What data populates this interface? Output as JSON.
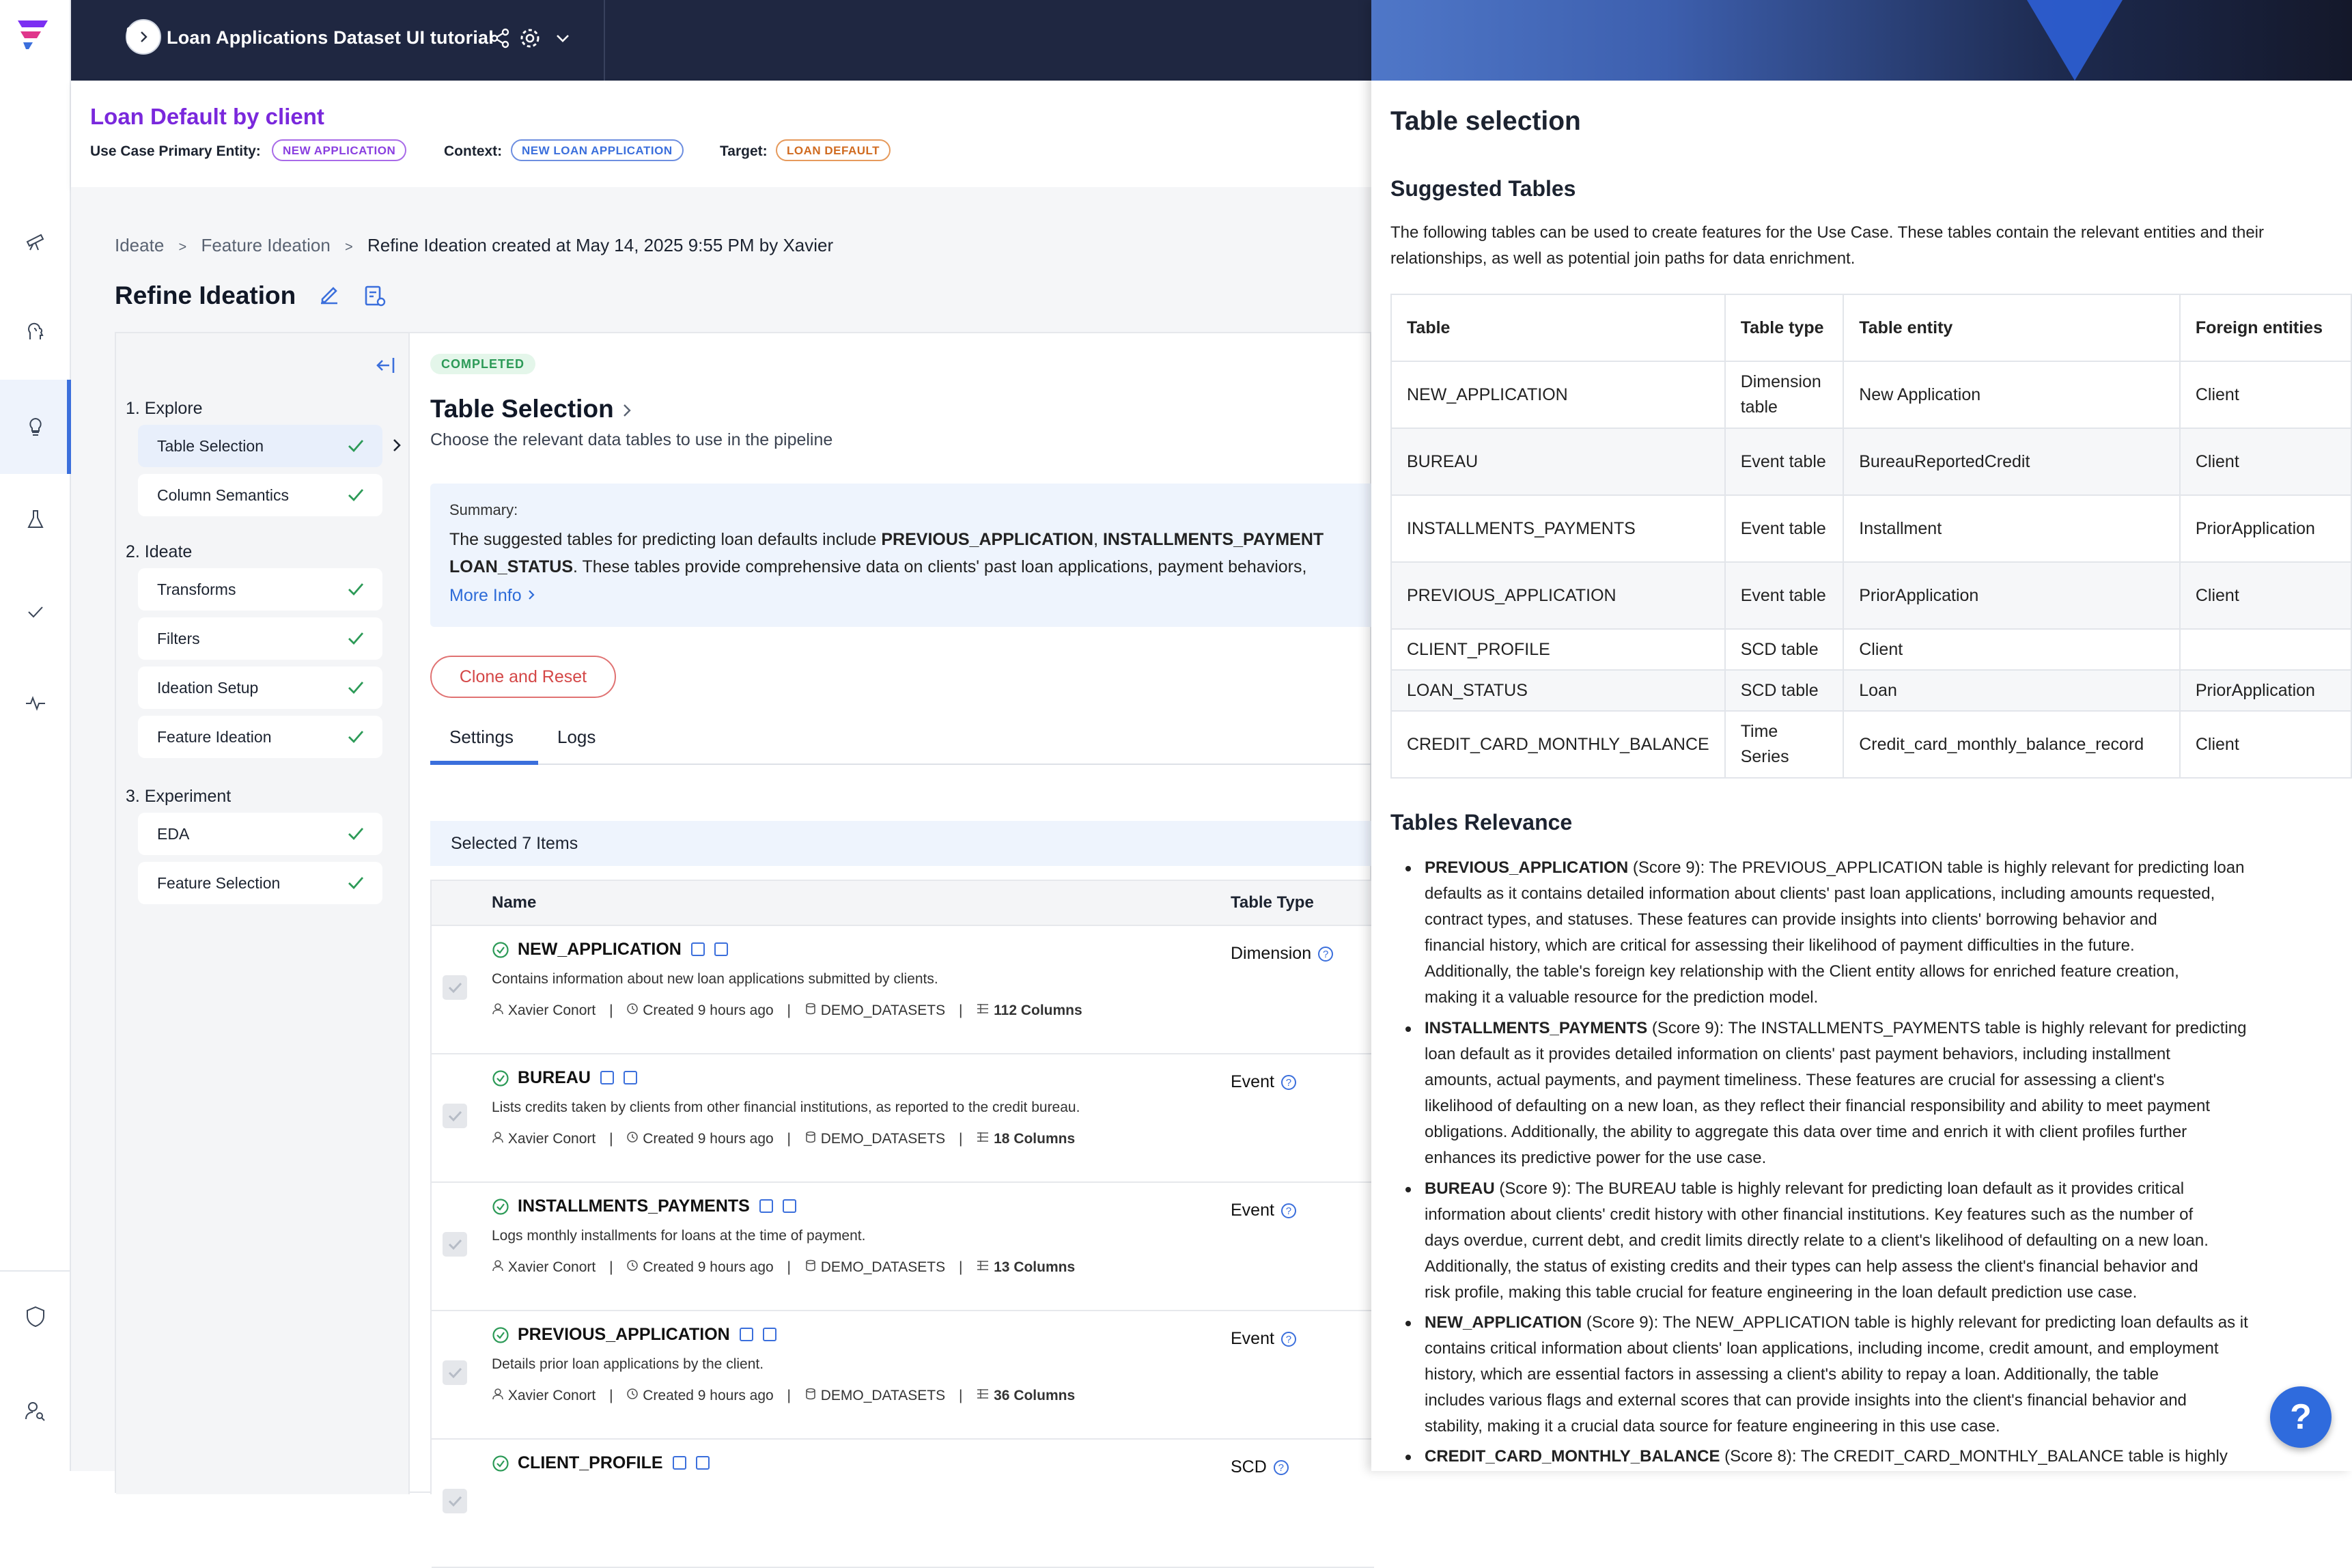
{
  "topbar": {
    "title": "Loan Applications Dataset UI tutorial"
  },
  "header": {
    "use_case_title": "Loan Default by client",
    "primary_entity_label": "Use Case Primary Entity:",
    "primary_entity": "NEW APPLICATION",
    "context_label": "Context:",
    "context": "NEW LOAN APPLICATION",
    "target_label": "Target:",
    "target": "LOAN DEFAULT"
  },
  "breadcrumb": [
    "Ideate",
    ">",
    "Feature Ideation",
    ">",
    "Refine Ideation created at May 14, 2025 9:55 PM by Xavier"
  ],
  "page_title": "Refine Ideation",
  "steps": {
    "explore": {
      "heading": "1. Explore",
      "items": [
        "Table Selection",
        "Column Semantics"
      ]
    },
    "ideate": {
      "heading": "2. Ideate",
      "items": [
        "Transforms",
        "Filters",
        "Ideation Setup",
        "Feature Ideation"
      ]
    },
    "experiment": {
      "heading": "3. Experiment",
      "items": [
        "EDA",
        "Feature Selection"
      ]
    }
  },
  "content": {
    "status": "COMPLETED",
    "title": "Table Selection",
    "subtitle": "Choose the relevant data tables to use in the pipeline",
    "summary_label": "Summary:",
    "summary_line1_pre": "The suggested tables for predicting loan defaults include ",
    "summary_line1_b1": "PREVIOUS_APPLICATION",
    "summary_line1_mid": ", ",
    "summary_line1_b2": "INSTALLMENTS_PAYMENT",
    "summary_line2_b": "LOAN_STATUS",
    "summary_line2_post": ". These tables provide comprehensive data on clients' past loan applications, payment behaviors,",
    "more_info": "More Info",
    "clone_button": "Clone and Reset",
    "tabs": [
      "Settings",
      "Logs"
    ],
    "selected_count": "Selected 7 Items",
    "columns": {
      "name": "Name",
      "table_type": "Table Type"
    }
  },
  "rows": [
    {
      "name": "NEW_APPLICATION",
      "desc": "Contains information about new loan applications submitted by clients.",
      "owner": "Xavier Conort",
      "created": "Created 9 hours ago",
      "source": "DEMO_DATASETS",
      "columns": "112 Columns",
      "type": "Dimension"
    },
    {
      "name": "BUREAU",
      "desc": "Lists credits taken by clients from other financial institutions, as reported to the credit bureau.",
      "owner": "Xavier Conort",
      "created": "Created 9 hours ago",
      "source": "DEMO_DATASETS",
      "columns": "18 Columns",
      "type": "Event"
    },
    {
      "name": "INSTALLMENTS_PAYMENTS",
      "desc": "Logs monthly installments for loans at the time of payment.",
      "owner": "Xavier Conort",
      "created": "Created 9 hours ago",
      "source": "DEMO_DATASETS",
      "columns": "13 Columns",
      "type": "Event"
    },
    {
      "name": "PREVIOUS_APPLICATION",
      "desc": "Details prior loan applications by the client.",
      "owner": "Xavier Conort",
      "created": "Created 9 hours ago",
      "source": "DEMO_DATASETS",
      "columns": "36 Columns",
      "type": "Event"
    },
    {
      "name": "CLIENT_PROFILE",
      "desc": "",
      "owner": "",
      "created": "",
      "source": "",
      "columns": "",
      "type": "SCD"
    }
  ],
  "panel": {
    "title": "Table selection",
    "suggested_heading": "Suggested Tables",
    "intro": "The following tables can be used to create features for the Use Case. These tables contain the relevant entities and their relationships, as well as potential join paths for data enrichment.",
    "table_headers": [
      "Table",
      "Table type",
      "Table entity",
      "Foreign entities"
    ],
    "table_rows": [
      [
        "NEW_APPLICATION",
        "Dimension table",
        "New Application",
        "Client"
      ],
      [
        "BUREAU",
        "Event table",
        "BureauReportedCredit",
        "Client"
      ],
      [
        "INSTALLMENTS_PAYMENTS",
        "Event table",
        "Installment",
        "PriorApplication"
      ],
      [
        "PREVIOUS_APPLICATION",
        "Event table",
        "PriorApplication",
        "Client"
      ],
      [
        "CLIENT_PROFILE",
        "SCD table",
        "Client",
        ""
      ],
      [
        "LOAN_STATUS",
        "SCD table",
        "Loan",
        "PriorApplication"
      ],
      [
        "CREDIT_CARD_MONTHLY_BALANCE",
        "Time Series",
        "Credit_card_monthly_balance_record",
        "Client"
      ]
    ],
    "relevance_heading": "Tables Relevance",
    "relevance": [
      {
        "name": "PREVIOUS_APPLICATION",
        "score": " (Score 9)",
        "lines": [
          "The PREVIOUS_APPLICATION table is highly relevant for predicting loan",
          "defaults as it contains detailed information about clients' past loan applications, including amounts requested,",
          "contract types, and statuses. These features can provide insights into clients' borrowing behavior and",
          "financial history, which are critical for assessing their likelihood of payment difficulties in the future.",
          "Additionally, the table's foreign key relationship with the Client entity allows for enriched feature creation,",
          "making it a valuable resource for the prediction model."
        ]
      },
      {
        "name": "INSTALLMENTS_PAYMENTS",
        "score": " (Score 9)",
        "lines": [
          "The INSTALLMENTS_PAYMENTS table is highly relevant for predicting",
          "loan default as it provides detailed information on clients' past payment behaviors, including installment",
          "amounts, actual payments, and payment timeliness. These features are crucial for assessing a client's",
          "likelihood of defaulting on a new loan, as they reflect their financial responsibility and ability to meet payment",
          "obligations. Additionally, the ability to aggregate this data over time and enrich it with client profiles further",
          "enhances its predictive power for the use case."
        ]
      },
      {
        "name": "BUREAU",
        "score": " (Score 9)",
        "lines": [
          "The BUREAU table is highly relevant for predicting loan default as it provides critical",
          "information about clients' credit history with other financial institutions. Key features such as the number of",
          "days overdue, current debt, and credit limits directly relate to a client's likelihood of defaulting on a new loan.",
          "Additionally, the status of existing credits and their types can help assess the client's financial behavior and",
          "risk profile, making this table crucial for feature engineering in the loan default prediction use case."
        ]
      },
      {
        "name": "NEW_APPLICATION",
        "score": " (Score 9)",
        "lines": [
          "The NEW_APPLICATION table is highly relevant for predicting loan defaults as it",
          "contains critical information about clients' loan applications, including income, credit amount, and employment",
          "history, which are essential factors in assessing a client's ability to repay a loan. Additionally, the table",
          "includes various flags and external scores that can provide insights into the client's financial behavior and",
          "stability, making it a crucial data source for feature engineering in this use case."
        ]
      },
      {
        "name": "CREDIT_CARD_MONTHLY_BALANCE",
        "score": " (Score 8)",
        "lines": [
          "The CREDIT_CARD_MONTHLY_BALANCE table is highly"
        ]
      }
    ],
    "help": "?"
  }
}
